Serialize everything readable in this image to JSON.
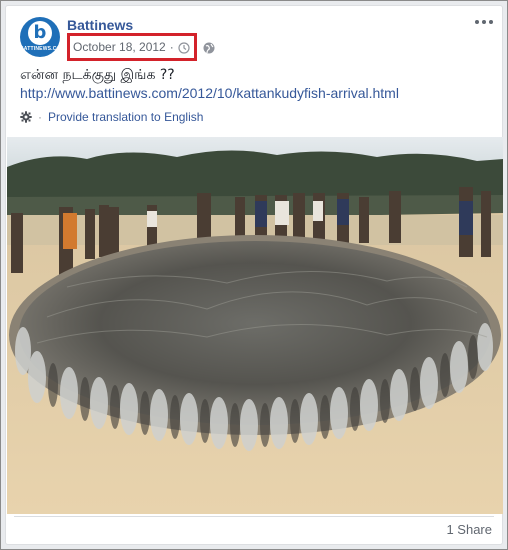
{
  "post": {
    "page_name": "Battinews",
    "avatar_text": "BATTINEWS.COM",
    "avatar_letter": "b",
    "date": "October 18, 2012",
    "separator": "·",
    "text": "என்ன நடக்குது இங்க ??",
    "link": "http://www.battinews.com/2012/10/kattankudyfish-arrival.html",
    "translate_label": "Provide translation to English",
    "photo_alt": "Fish piled on beach with crowd of people",
    "share_count": "1 Share"
  },
  "colors": {
    "link": "#365899",
    "highlight_box": "#d3222a",
    "background": "#e9ebee"
  },
  "icons": {
    "more": "more-horizontal-icon",
    "clock": "clock-icon",
    "privacy": "globe-icon",
    "translate": "gear-icon"
  }
}
